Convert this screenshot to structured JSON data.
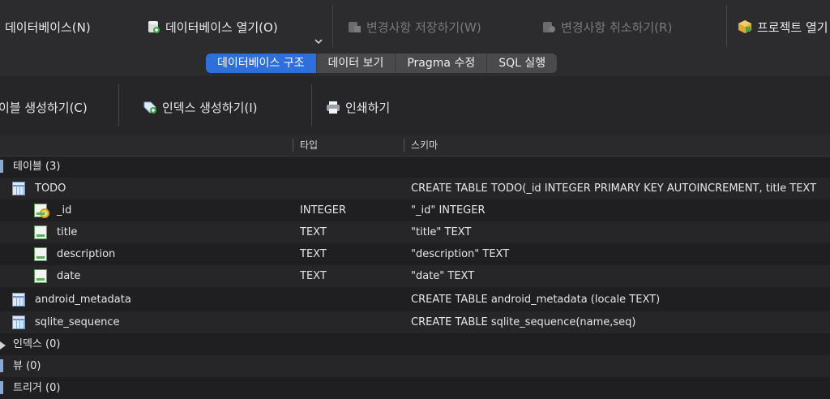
{
  "toolbar": {
    "new_db": "데이터베이스(N)",
    "open_db": "데이터베이스 열기(O)",
    "save_changes": "변경사항 저장하기(W)",
    "revert_changes": "변경사항 취소하기(R)",
    "open_project": "프로젝트 열기"
  },
  "tabs": [
    {
      "label": "데이터베이스 구조",
      "active": true
    },
    {
      "label": "데이터 보기",
      "active": false
    },
    {
      "label": "Pragma 수정",
      "active": false
    },
    {
      "label": "SQL 실행",
      "active": false
    }
  ],
  "subtoolbar": {
    "create_table": "이블 생성하기(C)",
    "create_index": "인덱스 생성하기(I)",
    "print": "인쇄하기"
  },
  "columns": {
    "name": "",
    "type": "타입",
    "schema": "스키마"
  },
  "tree": {
    "tables_header": "테이블 (3)",
    "todo": {
      "name": "TODO",
      "schema": "CREATE TABLE TODO(_id INTEGER PRIMARY KEY AUTOINCREMENT, title TEXT"
    },
    "todo_fields": [
      {
        "name": "_id",
        "type": "INTEGER",
        "schema": "\"_id\" INTEGER",
        "icon": "key-icon"
      },
      {
        "name": "title",
        "type": "TEXT",
        "schema": "\"title\" TEXT",
        "icon": "column-icon"
      },
      {
        "name": "description",
        "type": "TEXT",
        "schema": "\"description\" TEXT",
        "icon": "column-icon"
      },
      {
        "name": "date",
        "type": "TEXT",
        "schema": "\"date\" TEXT",
        "icon": "column-icon"
      }
    ],
    "android_metadata": {
      "name": "android_metadata",
      "schema": "CREATE TABLE android_metadata (locale TEXT)"
    },
    "sqlite_sequence": {
      "name": "sqlite_sequence",
      "schema": "CREATE TABLE sqlite_sequence(name,seq)"
    },
    "indexes_header": "인덱스 (0)",
    "views_header": "뷰 (0)",
    "triggers_header": "트리거 (0)"
  },
  "colors": {
    "accent": "#2f6fdc",
    "background": "#1f1f21",
    "toolbar": "#2c2c2e"
  }
}
